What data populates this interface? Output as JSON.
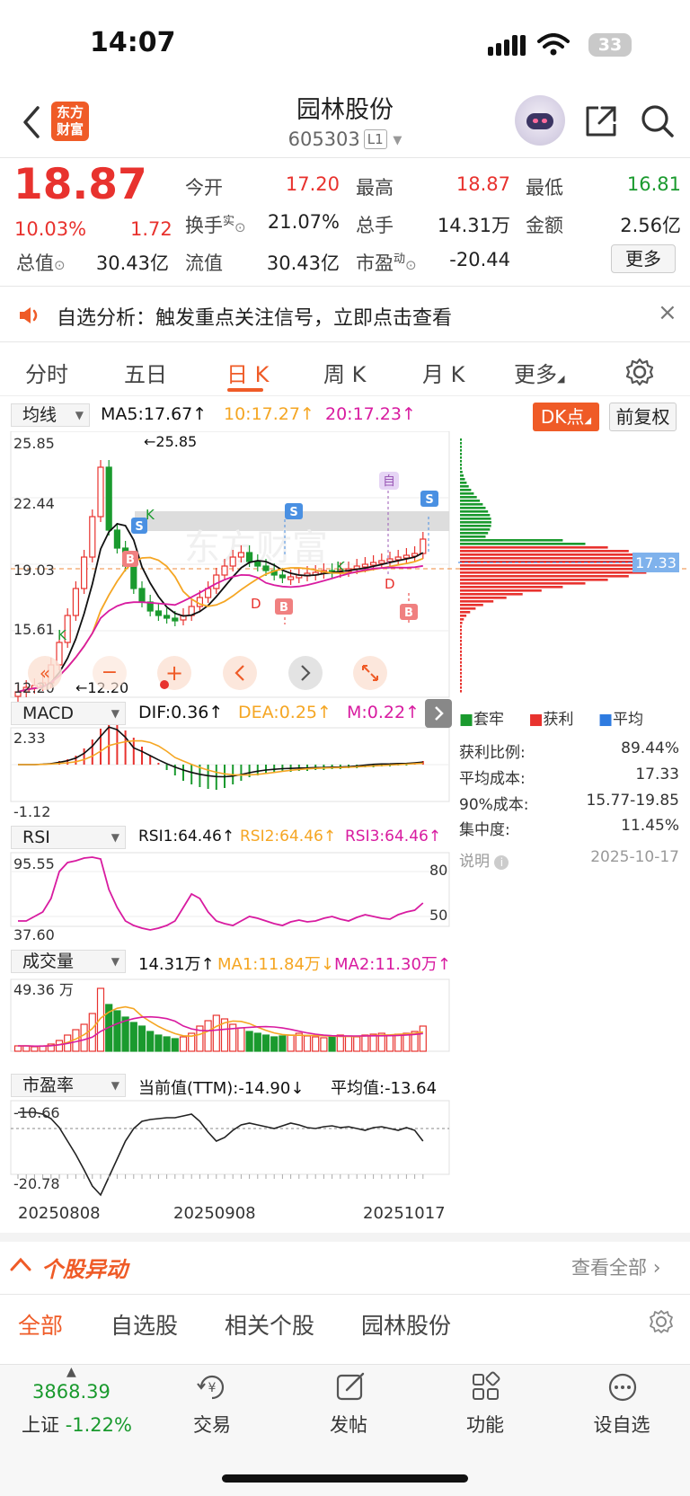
{
  "status": {
    "time": "14:07",
    "battery": "33"
  },
  "header": {
    "logo": "东方财富",
    "title": "园林股份",
    "code": "605303",
    "level": "L1"
  },
  "quote": {
    "price": "18.87",
    "change_pct": "10.03%",
    "change": "1.72",
    "open_label": "今开",
    "open": "17.20",
    "high_label": "最高",
    "high": "18.87",
    "low_label": "最低",
    "low": "16.81",
    "turnover_label": "换手",
    "turnover_sup": "实",
    "turnover": "21.07%",
    "volume_label": "总手",
    "volume": "14.31万",
    "amount_label": "金额",
    "amount": "2.56亿",
    "mktcap_label": "总值",
    "mktcap": "30.43亿",
    "float_label": "流值",
    "float": "30.43亿",
    "pe_label": "市盈",
    "pe_sup": "动",
    "pe": "-20.44",
    "more": "更多"
  },
  "notice": {
    "text": "自选分析：触发重点关注信号，立即点击查看",
    "close": "×"
  },
  "tabs": [
    "分时",
    "五日",
    "日 K",
    "周 K",
    "月 K",
    "更多"
  ],
  "active_tab": "日 K",
  "kline": {
    "ma_select": "均线",
    "ma5": "MA5:17.67↑",
    "ma10": "10:17.27↑",
    "ma20": "20:17.23↑",
    "dk_button": "DK点",
    "adjust_button": "前复权",
    "y_labels": [
      "25.85",
      "22.44",
      "19.03",
      "15.61",
      "12.20"
    ],
    "high_marker": "←25.85",
    "low_marker": "←12.20",
    "signal_labels": {
      "s": "S",
      "b": "B",
      "k": "K",
      "d": "D",
      "zi": "自"
    },
    "chip_avg": "17.33"
  },
  "chip_panel": {
    "legend": [
      "套牢",
      "获利",
      "平均"
    ],
    "legend_colors": [
      "#1a9a2e",
      "#e8322e",
      "#2e7be0"
    ],
    "rows": [
      {
        "label": "获利比例:",
        "value": "89.44%"
      },
      {
        "label": "平均成本:",
        "value": "17.33"
      },
      {
        "label": "90%成本:",
        "value": "15.77-19.85"
      },
      {
        "label": "集中度:",
        "value": "11.45%"
      }
    ],
    "note": "说明",
    "date": "2025-10-17"
  },
  "macd": {
    "select": "MACD",
    "dif": "DIF:0.36↑",
    "dea": "DEA:0.25↑",
    "m": "M:0.22↑",
    "y_top": "2.33",
    "y_bottom": "-1.12"
  },
  "rsi": {
    "select": "RSI",
    "rsi1": "RSI1:64.46↑",
    "rsi2": "RSI2:64.46↑",
    "rsi3": "RSI3:64.46↑",
    "y_top": "95.55",
    "y_bottom": "37.60",
    "level_80": "80",
    "level_50": "50"
  },
  "volume": {
    "select": "成交量",
    "current": "14.31万↑",
    "ma1": "MA1:11.84万↓",
    "ma2": "MA2:11.30万↑",
    "y_top": "49.36 万"
  },
  "pe_chart": {
    "select": "市盈率",
    "current": "当前值(TTM):-14.90↓",
    "average": "平均值:-13.64",
    "y_top": "-10.66",
    "y_bottom": "-20.78"
  },
  "dates": [
    "20250808",
    "20250908",
    "20251017"
  ],
  "movers": {
    "title": "个股异动",
    "view_all": "查看全部"
  },
  "filter_tabs": [
    "全部",
    "自选股",
    "相关个股",
    "园林股份"
  ],
  "bottom_bar": {
    "index_value": "3868.39",
    "index_name": "上证",
    "index_change": "-1.22%",
    "items": [
      "交易",
      "发帖",
      "功能",
      "设自选"
    ]
  },
  "colors": {
    "accent": "#ef5b27",
    "up": "#e8322e",
    "down": "#1a9a2e",
    "ma5": "#111111",
    "ma10": "#f5a623",
    "ma20": "#d81ba0"
  }
}
